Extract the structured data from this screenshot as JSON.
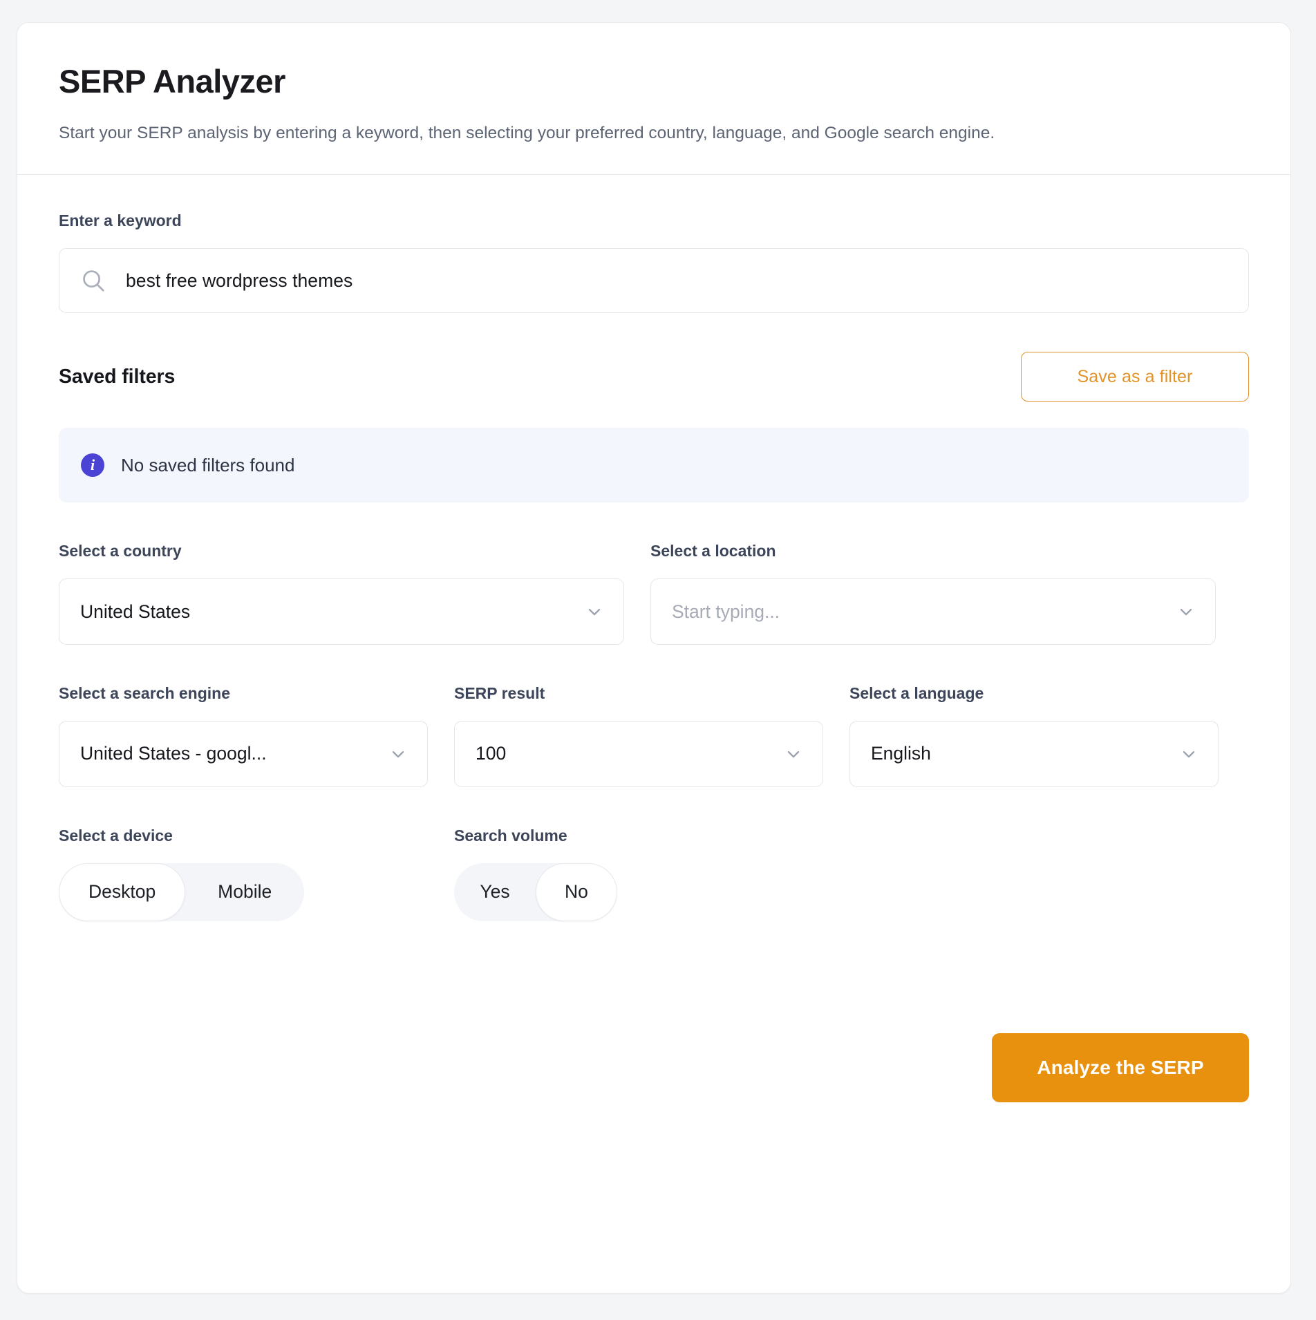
{
  "header": {
    "title": "SERP Analyzer",
    "subtitle": "Start your SERP analysis by entering a keyword, then selecting your preferred country, language, and Google search engine."
  },
  "keyword": {
    "label": "Enter a keyword",
    "value": "best free wordpress themes",
    "placeholder": "Enter a keyword",
    "icon": "search-icon"
  },
  "saved_filters": {
    "title": "Saved filters",
    "save_button": "Save as a filter",
    "empty_message": "No saved filters found",
    "info_icon_glyph": "i"
  },
  "country": {
    "label": "Select a country",
    "value": "United States"
  },
  "location": {
    "label": "Select a location",
    "value": "",
    "placeholder": "Start typing..."
  },
  "search_engine": {
    "label": "Select a search engine",
    "value": "United States - googl..."
  },
  "serp_result": {
    "label": "SERP result",
    "value": "100"
  },
  "language": {
    "label": "Select a language",
    "value": "English"
  },
  "device": {
    "label": "Select a device",
    "options": [
      {
        "label": "Desktop",
        "selected": true
      },
      {
        "label": "Mobile",
        "selected": false
      }
    ]
  },
  "search_volume": {
    "label": "Search volume",
    "options": [
      {
        "label": "Yes",
        "selected": false
      },
      {
        "label": "No",
        "selected": true
      }
    ]
  },
  "footer": {
    "analyze_button": "Analyze the SERP"
  },
  "colors": {
    "accent_orange": "#e8910f",
    "outline_orange": "#e29227",
    "info_purple": "#4a43d4",
    "info_bg": "#f4f6fd",
    "page_bg": "#f4f5f7",
    "text_primary": "#16181d",
    "text_muted": "#5d6575"
  }
}
